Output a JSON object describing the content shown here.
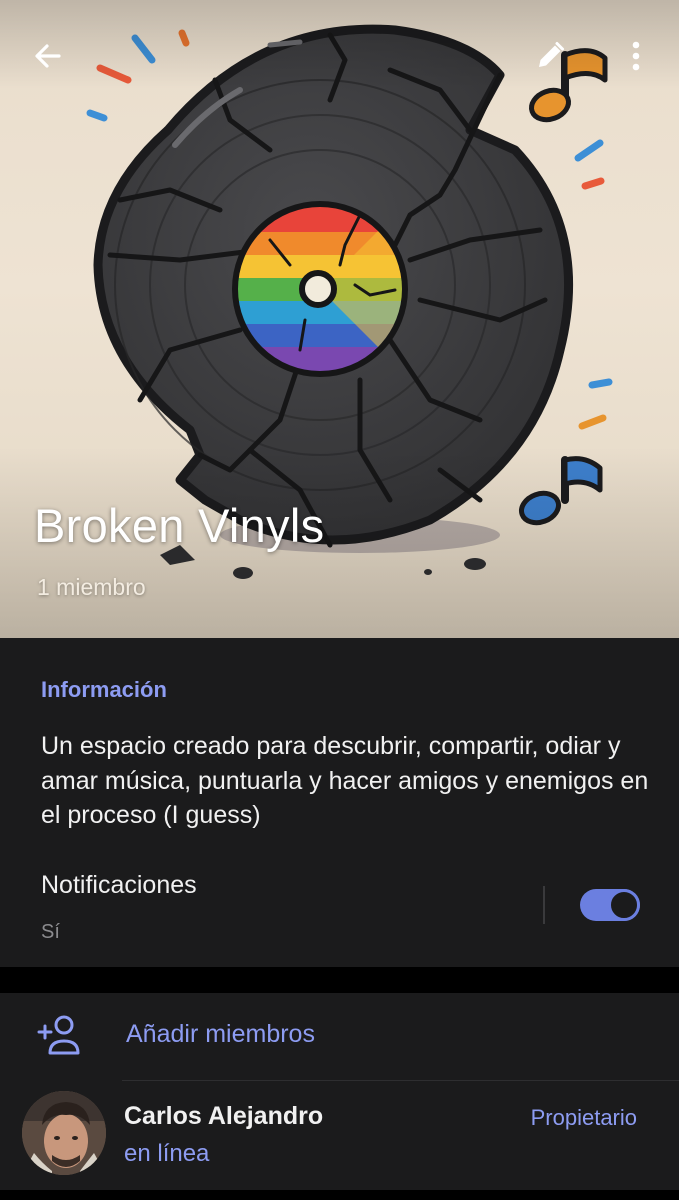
{
  "header": {
    "title": "Broken Vinyls",
    "subtitle": "1 miembro",
    "icons": {
      "back": "arrow-left-icon",
      "edit": "pencil-icon",
      "more": "more-vertical-icon"
    }
  },
  "info": {
    "heading": "Información",
    "description": "Un espacio creado para descubrir, compartir, odiar y amar música, puntuarla y hacer amigos y enemigos en el proceso (I guess)"
  },
  "notifications": {
    "label": "Notificaciones",
    "value": "Sí",
    "enabled": true
  },
  "members": {
    "add_label": "Añadir miembros",
    "list": [
      {
        "name": "Carlos Alejandro",
        "status": "en línea",
        "role": "Propietario"
      }
    ]
  },
  "colors": {
    "accent": "#8d9cf2",
    "toggle": "#6b7fe0",
    "panel": "#1b1b1c",
    "background": "#000000"
  }
}
